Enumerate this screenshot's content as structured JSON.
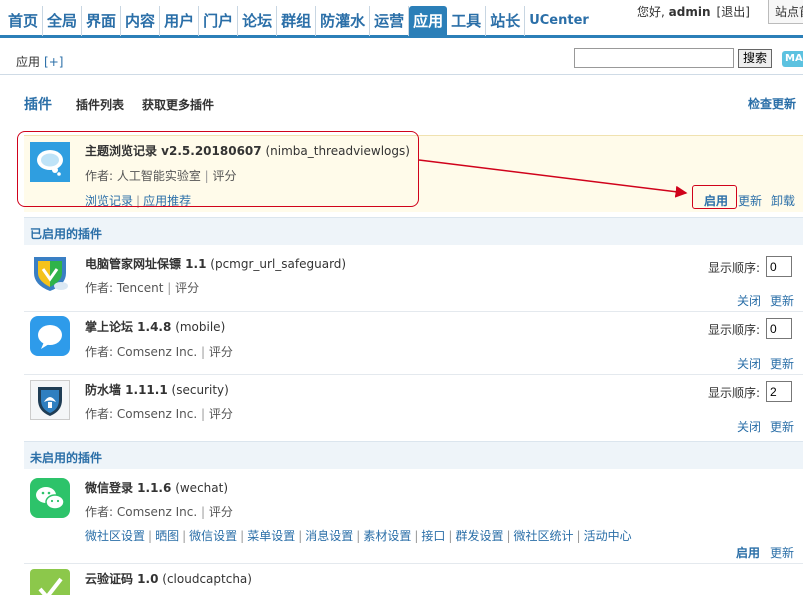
{
  "nav": {
    "items": [
      "首页",
      "全局",
      "界面",
      "内容",
      "用户",
      "门户",
      "论坛",
      "群组",
      "防灌水",
      "运营",
      "应用",
      "工具",
      "站长",
      "UCenter"
    ],
    "active_index": 10
  },
  "user": {
    "greeting": "您好,",
    "name": "admin",
    "logout": "[退出]",
    "site_button": "站点首页"
  },
  "subbar": {
    "crumb": "应用",
    "add": "[+]",
    "search_value": "",
    "search_button": "搜索",
    "badge": "MA"
  },
  "tabs": {
    "main": "插件",
    "list": "插件列表",
    "more": "获取更多插件",
    "check_update": "检查更新"
  },
  "highlight_plugin": {
    "name": "主题浏览记录 v2.5.20180607",
    "id": "(nimba_threadviewlogs)",
    "author": "作者: 人工智能实验室",
    "rate": "评分",
    "links": [
      "浏览记录",
      "应用推荐"
    ],
    "actions": [
      "启用",
      "更新",
      "卸载"
    ]
  },
  "enabled_section": {
    "title": "已启用的插件",
    "order_label": "显示顺序:",
    "plugins": [
      {
        "name": "电脑管家网址保镖 1.1",
        "id": "(pcmgr_url_safeguard)",
        "author": "作者: Tencent",
        "rate": "评分",
        "order": "0",
        "actions": [
          "关闭",
          "更新"
        ]
      },
      {
        "name": "掌上论坛 1.4.8",
        "id": "(mobile)",
        "author": "作者: Comsenz Inc.",
        "rate": "评分",
        "order": "0",
        "actions": [
          "关闭",
          "更新"
        ]
      },
      {
        "name": "防水墙 1.11.1",
        "id": "(security)",
        "author": "作者: Comsenz Inc.",
        "rate": "评分",
        "order": "2",
        "actions": [
          "关闭",
          "更新"
        ]
      }
    ]
  },
  "disabled_section": {
    "title": "未启用的插件",
    "plugins": [
      {
        "name": "微信登录 1.1.6",
        "id": "(wechat)",
        "author": "作者: Comsenz Inc.",
        "rate": "评分",
        "links": [
          "微社区设置",
          "晒图",
          "微信设置",
          "菜单设置",
          "消息设置",
          "素材设置",
          "接口",
          "群发设置",
          "微社区统计",
          "活动中心"
        ],
        "actions": [
          "启用",
          "更新"
        ]
      },
      {
        "name": "云验证码 1.0",
        "id": "(cloudcaptcha)"
      }
    ]
  },
  "colors": {
    "accent": "#2b7fb8",
    "link": "#2b6fa8",
    "highlight_bg": "#fffbea",
    "annotation_red": "#d0021b"
  }
}
